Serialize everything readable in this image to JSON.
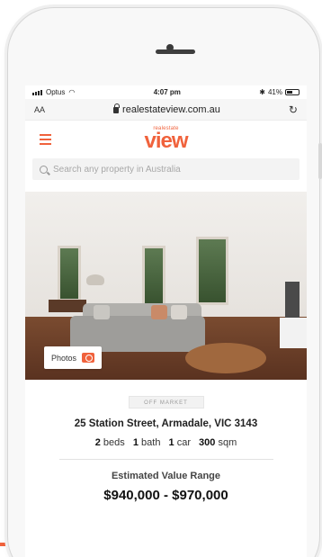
{
  "colors": {
    "brand": "#f0623c",
    "text": "#222222",
    "muted": "#a8a8a8"
  },
  "status_bar": {
    "carrier": "Optus",
    "time": "4:07 pm",
    "battery": "41%"
  },
  "browser": {
    "text_size_label": "AA",
    "url": "realestateview.com.au",
    "reload_icon": "reload-icon"
  },
  "site": {
    "logo_small": "realestate",
    "logo_big": "view",
    "menu_icon": "hamburger-icon",
    "search_placeholder": "Search any property in Australia"
  },
  "listing": {
    "photos_label": "Photos",
    "badge": "OFF MARKET",
    "address": "25 Station Street, Armadale, VIC 3143",
    "beds_value": "2",
    "beds_label": "beds",
    "bath_value": "1",
    "bath_label": "bath",
    "car_value": "1",
    "car_label": "car",
    "area_value": "300",
    "area_label": "sqm",
    "estimate_label": "Estimated Value Range",
    "estimate_value": "$940,000 - $970,000"
  }
}
